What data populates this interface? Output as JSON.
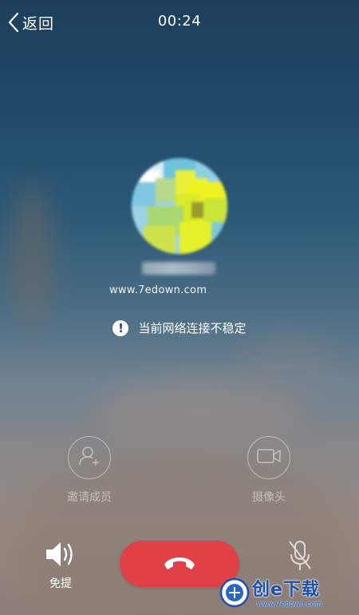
{
  "header": {
    "back_label": "返回",
    "timer": "00:24"
  },
  "contact": {
    "watermark": "www.7edown.com"
  },
  "status": {
    "warning_text": "当前网络连接不稳定"
  },
  "actions": {
    "invite_label": "邀请成员",
    "camera_label": "摄像头"
  },
  "controls": {
    "speaker_label": "免提",
    "hangup_color": "#e04147"
  },
  "site_logo": {
    "text": "创e下载",
    "url": "www.7edown.com"
  },
  "icons": {
    "back": "chevron-left-icon",
    "warning": "exclamation-icon",
    "invite": "add-user-icon",
    "camera": "video-camera-icon",
    "speaker": "speaker-icon",
    "hangup": "phone-hangup-icon",
    "mute": "mic-off-icon"
  }
}
